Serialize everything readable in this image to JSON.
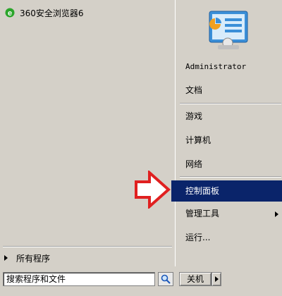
{
  "left": {
    "pinned": [
      {
        "label": "360安全浏览器6",
        "icon": "ie-browser-icon"
      }
    ],
    "all_programs": "所有程序"
  },
  "right": {
    "user_name": "Administrator",
    "items": [
      {
        "label": "文档"
      },
      {
        "label": "游戏"
      },
      {
        "label": "计算机"
      },
      {
        "label": "网络"
      },
      {
        "label": "控制面板"
      },
      {
        "label": "管理工具"
      },
      {
        "label": "运行..."
      }
    ]
  },
  "search": {
    "value": "搜索程序和文件"
  },
  "shutdown": {
    "label": "关机"
  },
  "colors": {
    "selection": "#0a246a",
    "menu_bg": "#d4d0c8",
    "callout_arrow": "#e02020"
  }
}
